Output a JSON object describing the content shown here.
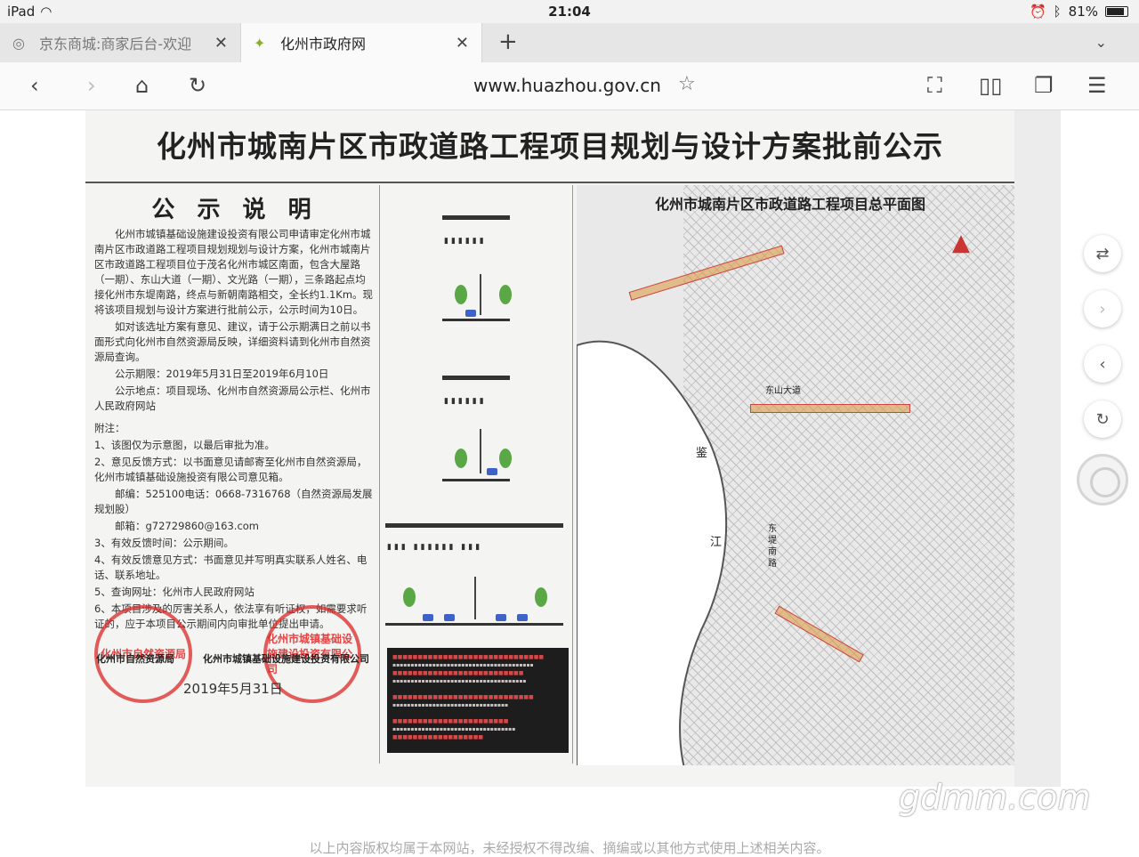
{
  "status_bar": {
    "device": "iPad",
    "time": "21:04",
    "battery": "81%"
  },
  "tabs": [
    {
      "label": "京东商城:商家后台-欢迎",
      "active": false
    },
    {
      "label": "化州市政府网",
      "active": true
    }
  ],
  "toolbar": {
    "url": "www.huazhou.gov.cn"
  },
  "poster": {
    "title": "化州市城南片区市政道路工程项目规划与设计方案批前公示",
    "notice_heading": "公 示 说 明",
    "paragraphs": [
      "化州市城镇基础设施建设投资有限公司申请审定化州市城南片区市政道路工程项目规划规划与设计方案，化州市城南片区市政道路工程项目位于茂名化州市城区南面，包含大屋路（一期）、东山大道（一期）、文光路（一期），三条路起点均接化州市东堤南路，终点与新朝南路相交，全长约1.1Km。现将该项目规划与设计方案进行批前公示，公示时间为10日。",
      "如对该选址方案有意见、建议，请于公示期满日之前以书面形式向化州市自然资源局反映，详细资料请到化州市自然资源局查询。",
      "公示期限：2019年5月31日至2019年6月10日",
      "公示地点：项目现场、化州市自然资源局公示栏、化州市人民政府网站"
    ],
    "notes_title": "附注：",
    "notes": [
      "1、该图仅为示意图，以最后审批为准。",
      "2、意见反馈方式：以书面意见请邮寄至化州市自然资源局，化州市城镇基础设施投资有限公司意见箱。",
      "邮编：525100电话：0668-7316768（自然资源局发展规划股）",
      "邮箱：g72729860@163.com",
      "3、有效反馈时间：公示期间。",
      "4、有效反馈意见方式：书面意见并写明真实联系人姓名、电话、联系地址。",
      "5、查询网址：化州市人民政府网站",
      "6、本项目涉及的厉害关系人，依法享有听证权，如需要求听证的，应于本项目公示期间内向审批单位提出申请。"
    ],
    "signer_left": "化州市自然资源局",
    "signer_right": "化州市城镇基础设施建设投资有限公司",
    "date": "2019年5月31日",
    "seal_left": "化州市自然资源局",
    "seal_right": "化州市城镇基础设施建设投资有限公司",
    "map_title": "化州市城南片区市政道路工程项目总平面图",
    "map_labels": [
      "东山大道",
      "鉴",
      "江",
      "东堤南路"
    ]
  },
  "footer": {
    "watermark": "gdmm.com",
    "copyright": "以上内容版权均属于本网站，未经授权不得改编、摘编或以其他方式使用上述相关内容。"
  }
}
